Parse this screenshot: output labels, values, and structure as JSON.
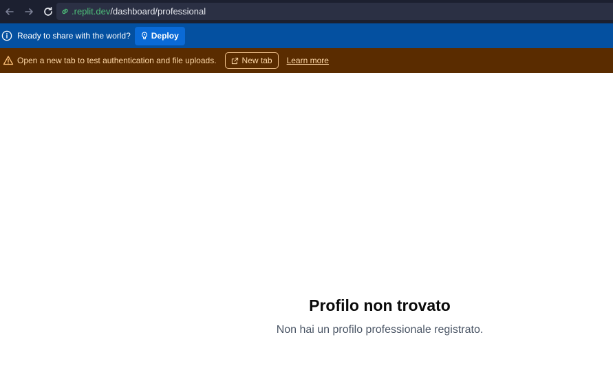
{
  "browser": {
    "url_host": ".replit.dev",
    "url_path": "/dashboard/professional",
    "icons": [
      "back-arrow-icon",
      "forward-arrow-icon",
      "reload-icon",
      "link-icon"
    ]
  },
  "deploy_banner": {
    "message": "Ready to share with the world?",
    "button_label": "Deploy",
    "bg_color": "#0450a0"
  },
  "warning_banner": {
    "message": "Open a new tab to test authentication and file uploads.",
    "new_tab_label": "New tab",
    "learn_more_label": "Learn more",
    "bg_color": "#5a2c00"
  },
  "main": {
    "title": "Profilo non trovato",
    "subtitle": "Non hai un profilo professionale registrato."
  }
}
